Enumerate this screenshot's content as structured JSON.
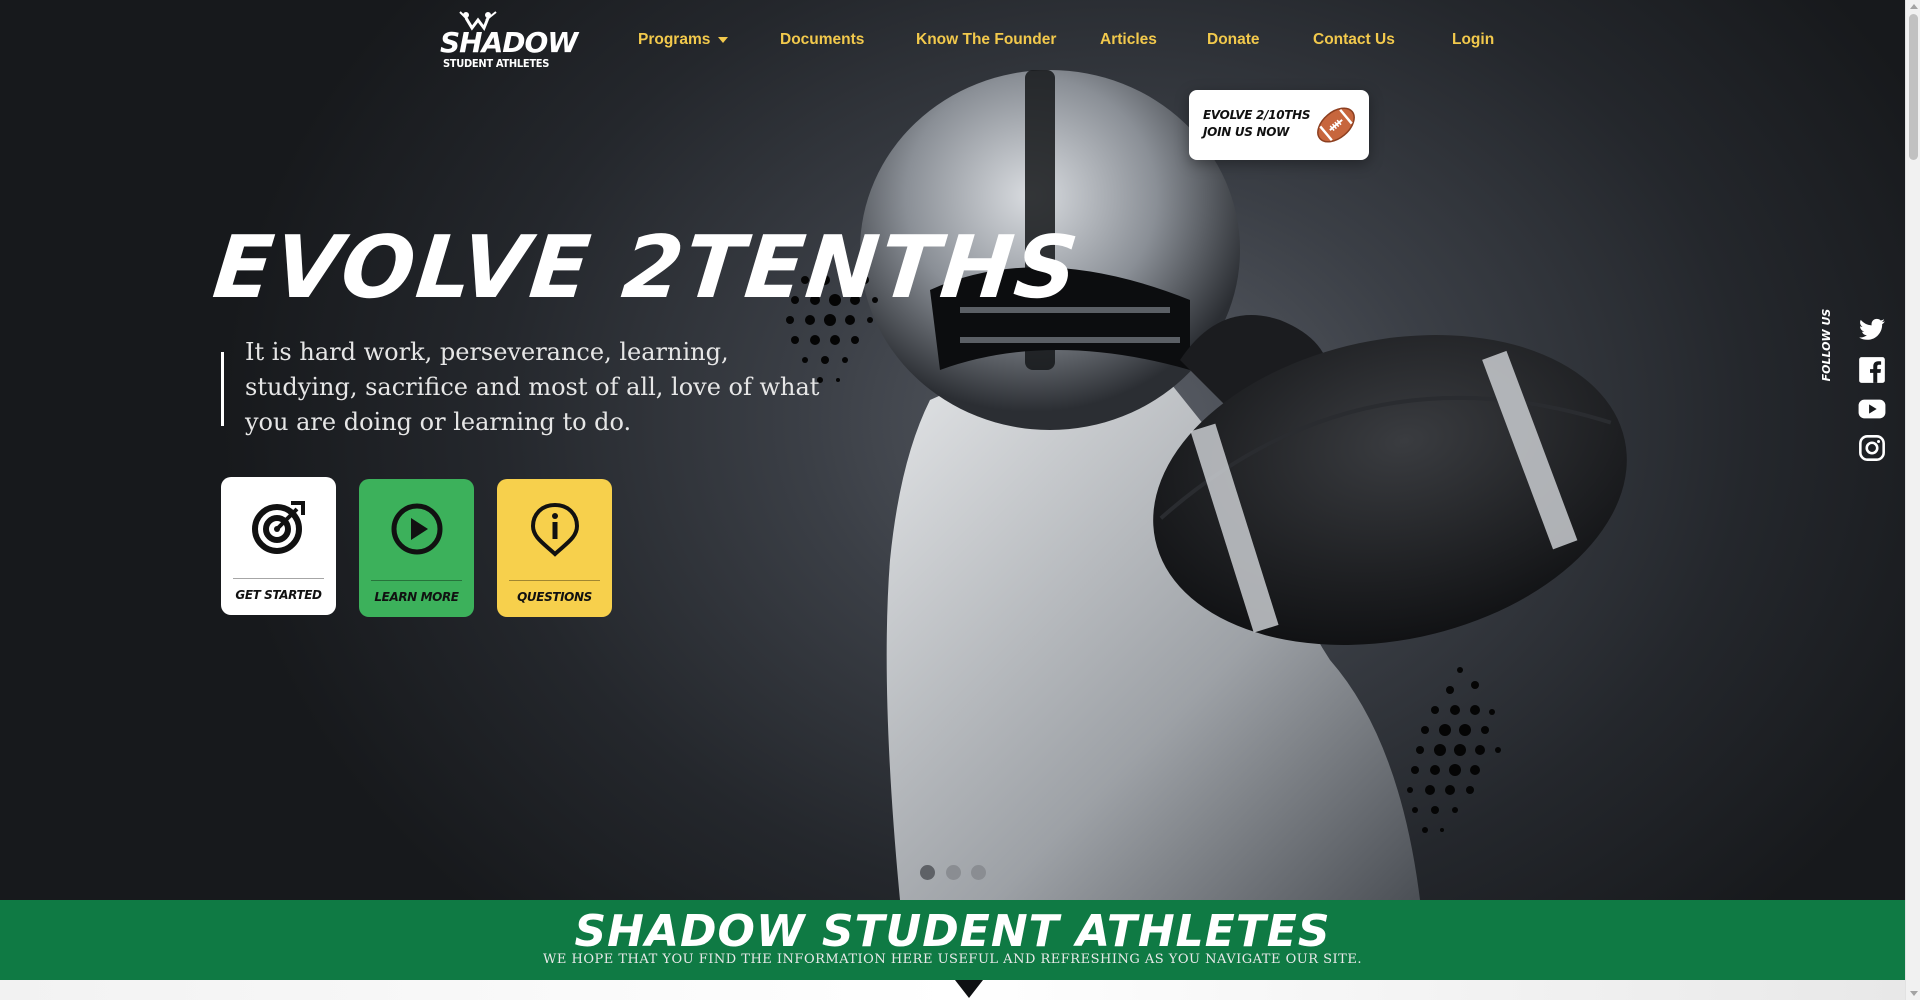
{
  "logo": {
    "line1": "SHADOW",
    "line2": "STUDENT ATHLETES"
  },
  "nav": {
    "programs": "Programs",
    "documents": "Documents",
    "founder": "Know The Founder",
    "articles": "Articles",
    "donate": "Donate",
    "contact": "Contact Us",
    "login": "Login"
  },
  "badge": {
    "line1": "EVOLVE 2/10THS",
    "line2": "JOIN US NOW",
    "icon": "football-icon"
  },
  "hero": {
    "headline": "EVOLVE 2TENTHS",
    "quote": "It is hard work, perseverance, learning, studying, sacrifice and most of all, love of what you are doing or learning to do."
  },
  "cta": [
    {
      "label": "GET STARTED",
      "icon": "target-icon",
      "color": "#ffffff"
    },
    {
      "label": "LEARN MORE",
      "icon": "play-icon",
      "color": "#3cb15b"
    },
    {
      "label": "QUESTIONS",
      "icon": "info-pin-icon",
      "color": "#f7d04c"
    }
  ],
  "social": {
    "follow_label": "FOLLOW US",
    "icons": [
      "twitter-icon",
      "facebook-icon",
      "youtube-icon",
      "instagram-icon"
    ]
  },
  "slider": {
    "dot_count": 3,
    "active_index": 0
  },
  "band": {
    "title": "SHADOW STUDENT ATHLETES",
    "subtitle": "WE HOPE THAT YOU FIND THE INFORMATION HERE USEFUL AND REFRESHING AS YOU NAVIGATE OUR SITE."
  },
  "colors": {
    "nav_text": "#f2c94c",
    "band_green": "#0f7a44",
    "cta_green": "#3cb15b",
    "cta_yellow": "#f7d04c"
  }
}
